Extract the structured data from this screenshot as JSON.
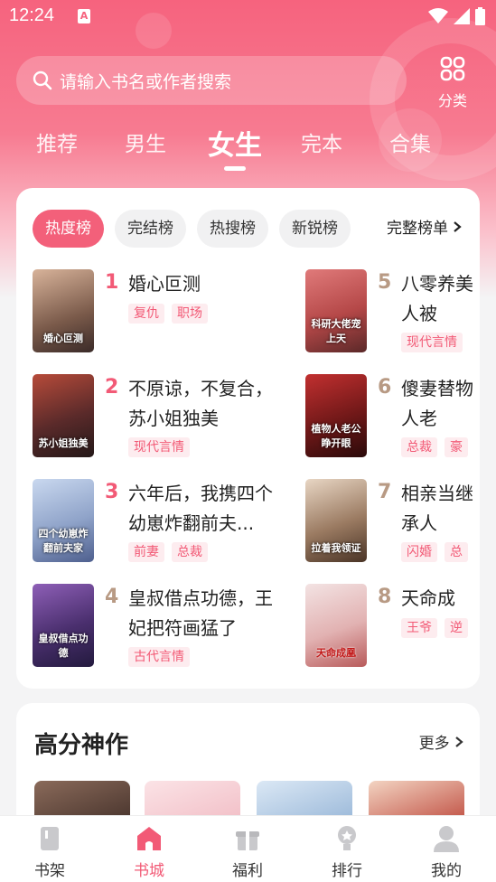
{
  "status_bar": {
    "time": "12:24",
    "badge": "A"
  },
  "search": {
    "placeholder": "请输入书名或作者搜索",
    "category_label": "分类"
  },
  "tabs": [
    {
      "label": "推荐",
      "active": false
    },
    {
      "label": "男生",
      "active": false
    },
    {
      "label": "女生",
      "active": true
    },
    {
      "label": "完本",
      "active": false
    },
    {
      "label": "合集",
      "active": false
    }
  ],
  "ranking": {
    "chips": [
      {
        "label": "热度榜",
        "active": true
      },
      {
        "label": "完结榜",
        "active": false
      },
      {
        "label": "热搜榜",
        "active": false
      },
      {
        "label": "新锐榜",
        "active": false
      }
    ],
    "more_label": "完整榜单",
    "books": [
      {
        "rank": "1",
        "title": "婚心叵测",
        "tags": [
          "复仇",
          "职场"
        ],
        "cover_text": "婚心叵测"
      },
      {
        "rank": "2",
        "title": "不原谅，不复合，苏小姐独美",
        "tags": [
          "现代言情"
        ],
        "cover_text": "苏小姐独美"
      },
      {
        "rank": "3",
        "title": "六年后，我携四个幼崽炸翻前夫...",
        "tags": [
          "前妻",
          "总裁"
        ],
        "cover_text": "四个幼崽炸翻前夫家"
      },
      {
        "rank": "4",
        "title": "皇叔借点功德，王妃把符画猛了",
        "tags": [
          "古代言情"
        ],
        "cover_text": "皇叔借点功德"
      },
      {
        "rank": "5",
        "title": "八零养美人被",
        "tags": [
          "现代言情"
        ],
        "cover_text": "科研大佬宠上天"
      },
      {
        "rank": "6",
        "title": "傻妻替物人老",
        "tags": [
          "总裁",
          "豪"
        ],
        "cover_text": "植物人老公睁开眼"
      },
      {
        "rank": "7",
        "title": "相亲当继承人",
        "tags": [
          "闪婚",
          "总"
        ],
        "cover_text": "拉着我领证"
      },
      {
        "rank": "8",
        "title": "天命成",
        "tags": [
          "王爷",
          "逆"
        ],
        "cover_text": "天命成凰"
      }
    ]
  },
  "section2": {
    "title": "高分神作",
    "more_label": "更多"
  },
  "bottom_nav": [
    {
      "label": "书架",
      "icon": "book-icon",
      "active": false
    },
    {
      "label": "书城",
      "icon": "store-icon",
      "active": true
    },
    {
      "label": "福利",
      "icon": "gift-icon",
      "active": false
    },
    {
      "label": "排行",
      "icon": "trophy-icon",
      "active": false
    },
    {
      "label": "我的",
      "icon": "user-icon",
      "active": false
    }
  ],
  "colors": {
    "brand": "#f25a76",
    "header_top": "#f6637e",
    "tag_bg": "#fdecef"
  }
}
